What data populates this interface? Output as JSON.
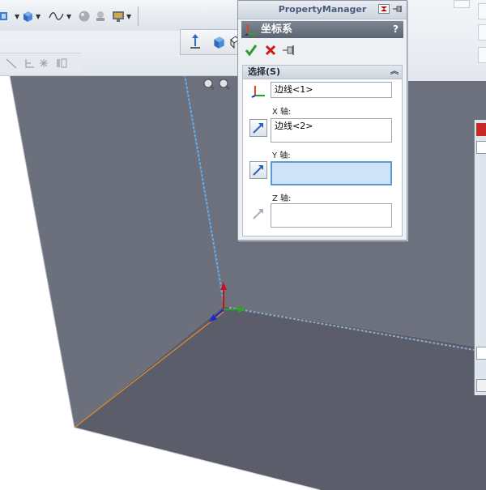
{
  "property_manager": {
    "title": "PropertyManager",
    "feature_name": "坐标系",
    "help_label": "?",
    "group": {
      "title": "选择(S)",
      "origin_value": "边线<1>",
      "x_axis_label": "X 轴:",
      "x_axis_value": "边线<2>",
      "y_axis_label": "Y 轴:",
      "y_axis_value": "",
      "z_axis_label": "Z 轴:",
      "z_axis_value": ""
    }
  },
  "icons": {
    "ok": "checkmark-icon",
    "cancel": "cancel-x-icon",
    "pin": "pushpin-icon",
    "coordinate_system": "coordinate-system-icon",
    "collapse": "collapse-chevrons-icon"
  },
  "colors": {
    "model_face": "#6b6e7b",
    "model_floor": "#5a5c68",
    "selected_edge": "#4aa8ff",
    "x_triad": "#2aa52a",
    "y_triad": "#cc1111",
    "z_triad": "#1a2acc",
    "active_field": "#cfe3f7"
  }
}
